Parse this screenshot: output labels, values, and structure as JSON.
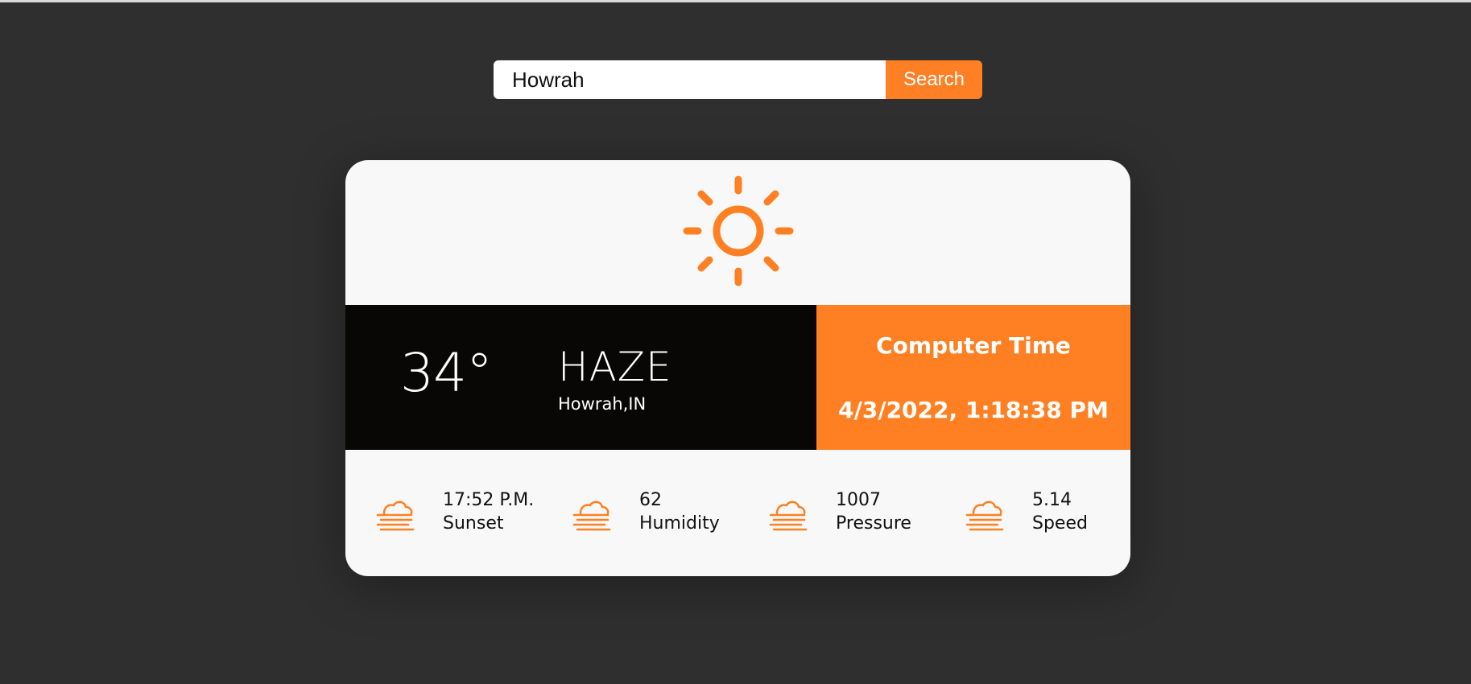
{
  "search": {
    "value": "Howrah",
    "button_label": "Search"
  },
  "weather": {
    "icon": "sun-icon",
    "temperature": "34°",
    "condition": "HAZE",
    "location": "Howrah,IN"
  },
  "time_panel": {
    "title": "Computer Time",
    "value": "4/3/2022, 1:18:38 PM"
  },
  "stats": [
    {
      "icon": "haze-icon",
      "value": "17:52 P.M.",
      "label": "Sunset"
    },
    {
      "icon": "haze-icon",
      "value": "62",
      "label": "Humidity"
    },
    {
      "icon": "haze-icon",
      "value": "1007",
      "label": "Pressure"
    },
    {
      "icon": "haze-icon",
      "value": "5.14",
      "label": "Speed"
    }
  ],
  "colors": {
    "background": "#2f2f2f",
    "accent": "#ff8022",
    "card": "#f8f8f8",
    "dark_panel": "#080706"
  }
}
